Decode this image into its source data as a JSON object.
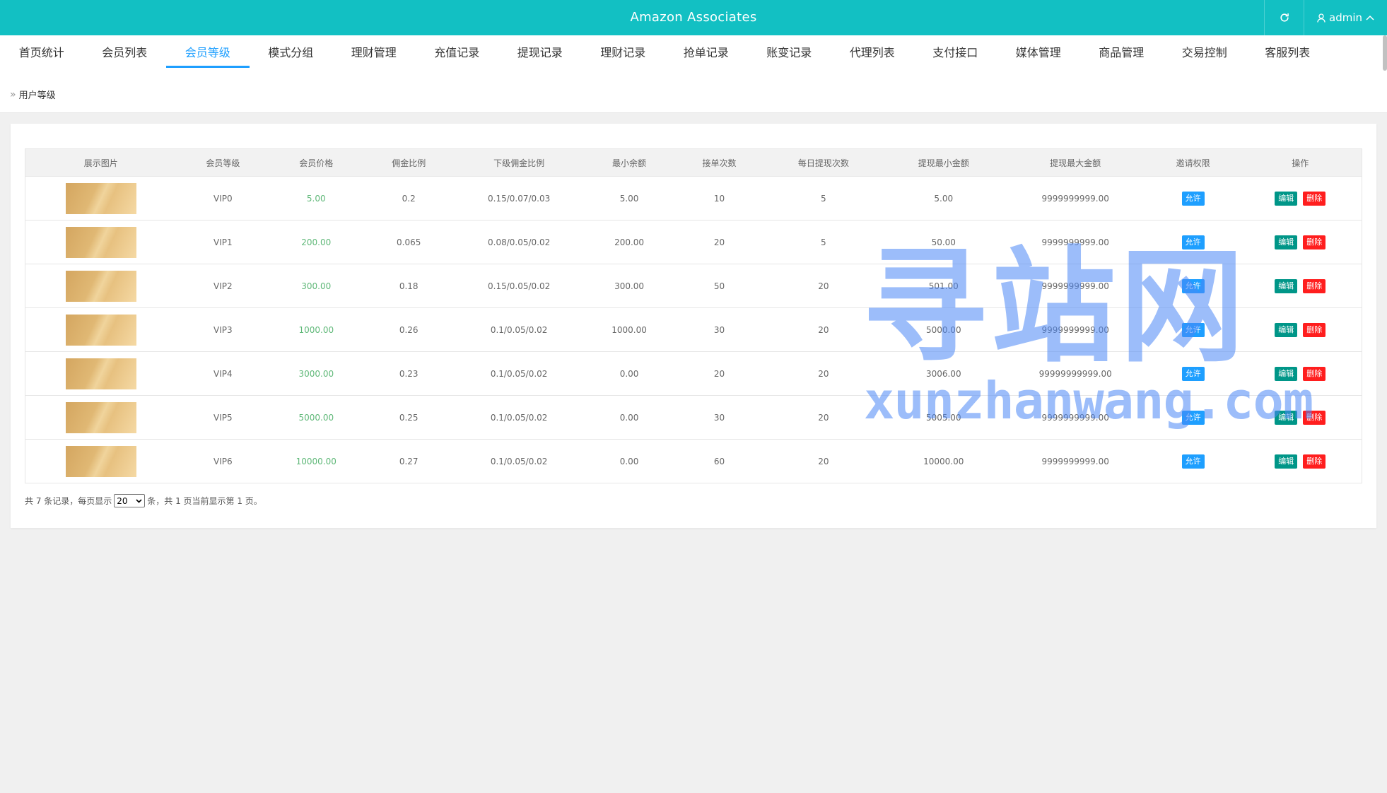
{
  "header": {
    "title": "Amazon Associates",
    "user": "admin",
    "bg_color": "#12c0c3"
  },
  "nav": {
    "tabs": [
      {
        "label": "首页统计",
        "active": false
      },
      {
        "label": "会员列表",
        "active": false
      },
      {
        "label": "会员等级",
        "active": true
      },
      {
        "label": "模式分组",
        "active": false
      },
      {
        "label": "理财管理",
        "active": false
      },
      {
        "label": "充值记录",
        "active": false
      },
      {
        "label": "提现记录",
        "active": false
      },
      {
        "label": "理财记录",
        "active": false
      },
      {
        "label": "抢单记录",
        "active": false
      },
      {
        "label": "账变记录",
        "active": false
      },
      {
        "label": "代理列表",
        "active": false
      },
      {
        "label": "支付接口",
        "active": false
      },
      {
        "label": "媒体管理",
        "active": false
      },
      {
        "label": "商品管理",
        "active": false
      },
      {
        "label": "交易控制",
        "active": false
      },
      {
        "label": "客服列表",
        "active": false
      }
    ],
    "active_color": "#1e9fff"
  },
  "breadcrumb": "用户等级",
  "table": {
    "columns": [
      "展示图片",
      "会员等级",
      "会员价格",
      "佣金比例",
      "下级佣金比例",
      "最小余额",
      "接单次数",
      "每日提现次数",
      "提现最小金额",
      "提现最大金额",
      "邀请权限",
      "操作"
    ],
    "rows": [
      {
        "level": "VIP0",
        "price": "5.00",
        "commission": "0.2",
        "sub_commission": "0.15/0.07/0.03",
        "min_balance": "5.00",
        "orders": "10",
        "daily_withdrawals": "5",
        "withdraw_min": "5.00",
        "withdraw_max": "9999999999.00",
        "invite": "允许"
      },
      {
        "level": "VIP1",
        "price": "200.00",
        "commission": "0.065",
        "sub_commission": "0.08/0.05/0.02",
        "min_balance": "200.00",
        "orders": "20",
        "daily_withdrawals": "5",
        "withdraw_min": "50.00",
        "withdraw_max": "9999999999.00",
        "invite": "允许"
      },
      {
        "level": "VIP2",
        "price": "300.00",
        "commission": "0.18",
        "sub_commission": "0.15/0.05/0.02",
        "min_balance": "300.00",
        "orders": "50",
        "daily_withdrawals": "20",
        "withdraw_min": "501.00",
        "withdraw_max": "9999999999.00",
        "invite": "允许"
      },
      {
        "level": "VIP3",
        "price": "1000.00",
        "commission": "0.26",
        "sub_commission": "0.1/0.05/0.02",
        "min_balance": "1000.00",
        "orders": "30",
        "daily_withdrawals": "20",
        "withdraw_min": "5000.00",
        "withdraw_max": "9999999999.00",
        "invite": "允许"
      },
      {
        "level": "VIP4",
        "price": "3000.00",
        "commission": "0.23",
        "sub_commission": "0.1/0.05/0.02",
        "min_balance": "0.00",
        "orders": "20",
        "daily_withdrawals": "20",
        "withdraw_min": "3006.00",
        "withdraw_max": "99999999999.00",
        "invite": "允许"
      },
      {
        "level": "VIP5",
        "price": "5000.00",
        "commission": "0.25",
        "sub_commission": "0.1/0.05/0.02",
        "min_balance": "0.00",
        "orders": "30",
        "daily_withdrawals": "20",
        "withdraw_min": "5005.00",
        "withdraw_max": "9999999999.00",
        "invite": "允许"
      },
      {
        "level": "VIP6",
        "price": "10000.00",
        "commission": "0.27",
        "sub_commission": "0.1/0.05/0.02",
        "min_balance": "0.00",
        "orders": "60",
        "daily_withdrawals": "20",
        "withdraw_min": "10000.00",
        "withdraw_max": "9999999999.00",
        "invite": "允许"
      }
    ],
    "edit_label": "编辑",
    "delete_label": "删除"
  },
  "pager": {
    "prefix": "共 7 条记录，每页显示",
    "page_size": "20",
    "suffix": "条，共 1 页当前显示第 1 页。"
  },
  "watermark": {
    "cn": "寻站网",
    "en": "xunzhanwang.com"
  },
  "icons": {
    "refresh": "refresh-icon",
    "user": "user-icon",
    "user_menu": "chevron-up-icon",
    "breadcrumb": "double-chevron-right-icon"
  }
}
